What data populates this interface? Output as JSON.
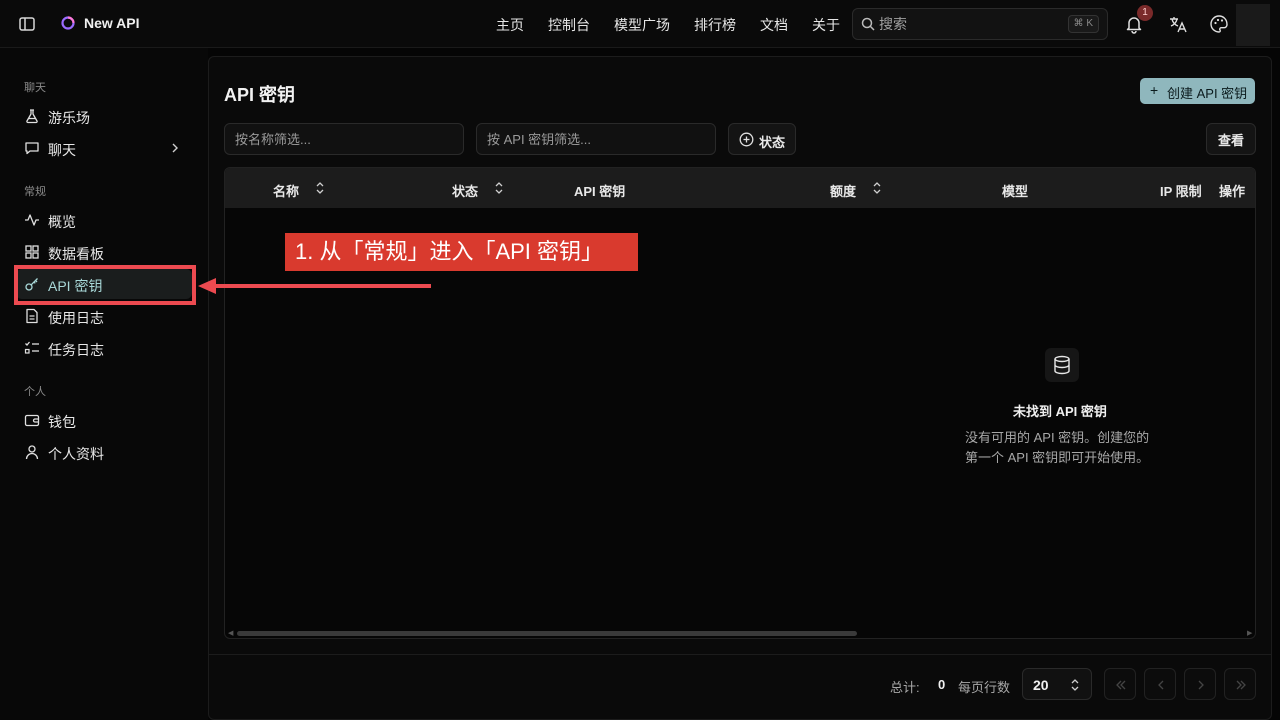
{
  "header": {
    "app_title": "New API",
    "nav": [
      "主页",
      "控制台",
      "模型广场",
      "排行榜",
      "文档",
      "关于"
    ],
    "search": {
      "placeholder": "搜索",
      "shortcut": "⌘ K"
    },
    "notification_count": "1"
  },
  "sidebar": {
    "sections": [
      {
        "label": "聊天",
        "items": [
          {
            "label": "游乐场",
            "icon": "flask-icon"
          },
          {
            "label": "聊天",
            "icon": "chat-icon",
            "has_submenu": true
          }
        ]
      },
      {
        "label": "常规",
        "items": [
          {
            "label": "概览",
            "icon": "activity-icon"
          },
          {
            "label": "数据看板",
            "icon": "dashboard-icon"
          },
          {
            "label": "API 密钥",
            "icon": "key-icon",
            "active": true
          },
          {
            "label": "使用日志",
            "icon": "file-text-icon"
          },
          {
            "label": "任务日志",
            "icon": "list-check-icon"
          }
        ]
      },
      {
        "label": "个人",
        "items": [
          {
            "label": "钱包",
            "icon": "wallet-icon"
          },
          {
            "label": "个人资料",
            "icon": "user-icon"
          }
        ]
      }
    ]
  },
  "main": {
    "title": "API 密钥",
    "create_button": "创建 API 密钥",
    "filters": {
      "name_placeholder": "按名称筛选...",
      "key_placeholder": "按 API 密钥筛选...",
      "status_button": "状态",
      "view_button": "查看"
    },
    "columns": [
      "名称",
      "状态",
      "API 密钥",
      "额度",
      "模型",
      "IP 限制",
      "操作"
    ],
    "empty": {
      "title": "未找到 API 密钥",
      "line1": "没有可用的 API 密钥。创建您的",
      "line2": "第一个 API 密钥即可开始使用。"
    },
    "footer": {
      "total_label": "总计:",
      "total_value": "0",
      "rows_per_page_label": "每页行数",
      "rows_per_page_value": "20"
    }
  },
  "annotation": {
    "text": "1. 从「常规」进入「API 密钥」"
  },
  "colors": {
    "accent": "#8fb7bd",
    "annotation_red": "#d93a2e",
    "highlight_border": "#ec4a50"
  }
}
